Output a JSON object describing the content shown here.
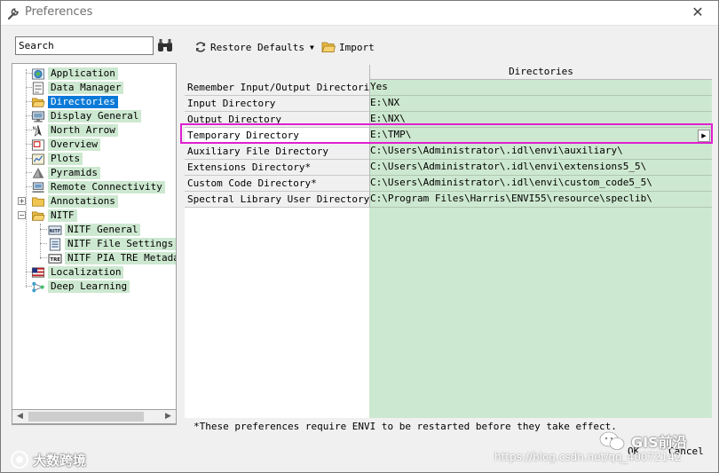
{
  "window": {
    "title": "Preferences",
    "close_label": "✕"
  },
  "search": {
    "value": "Search"
  },
  "toolbar": {
    "restore_label": "Restore Defaults",
    "import_label": "Import"
  },
  "tree": {
    "items": [
      {
        "label": "Application"
      },
      {
        "label": "Data Manager"
      },
      {
        "label": "Directories",
        "selected": true
      },
      {
        "label": "Display General"
      },
      {
        "label": "North Arrow"
      },
      {
        "label": "Overview"
      },
      {
        "label": "Plots"
      },
      {
        "label": "Pyramids"
      },
      {
        "label": "Remote Connectivity"
      },
      {
        "label": "Annotations"
      },
      {
        "label": "NITF"
      },
      {
        "label": "NITF General"
      },
      {
        "label": "NITF File Settings"
      },
      {
        "label": "NITF PIA TRE Metadat"
      },
      {
        "label": "Localization"
      },
      {
        "label": "Deep Learning"
      }
    ]
  },
  "grid": {
    "header": "Directories",
    "rows": [
      {
        "name": "Remember Input/Output Directories",
        "value": "Yes"
      },
      {
        "name": "Input Directory",
        "value": "E:\\NX"
      },
      {
        "name": "Output Directory",
        "value": "E:\\NX\\"
      },
      {
        "name": "Temporary Directory",
        "value": "E:\\TMP\\"
      },
      {
        "name": "Auxiliary File Directory",
        "value": "C:\\Users\\Administrator\\.idl\\envi\\auxiliary\\"
      },
      {
        "name": "Extensions Directory*",
        "value": "C:\\Users\\Administrator\\.idl\\envi\\extensions5_5\\"
      },
      {
        "name": "Custom Code Directory*",
        "value": "C:\\Users\\Administrator\\.idl\\envi\\custom_code5_5\\"
      },
      {
        "name": "Spectral Library User Directory",
        "value": "C:\\Program Files\\Harris\\ENVI55\\resource\\speclib\\"
      }
    ]
  },
  "footnote": "*These preferences require ENVI to be restarted before they take effect.",
  "buttons": {
    "ok": "OK",
    "cancel": "Cancel"
  },
  "watermarks": {
    "left": "大数跨境",
    "right": "GIS前沿",
    "url": "https://blog.csdn.net/qq_40072142"
  }
}
